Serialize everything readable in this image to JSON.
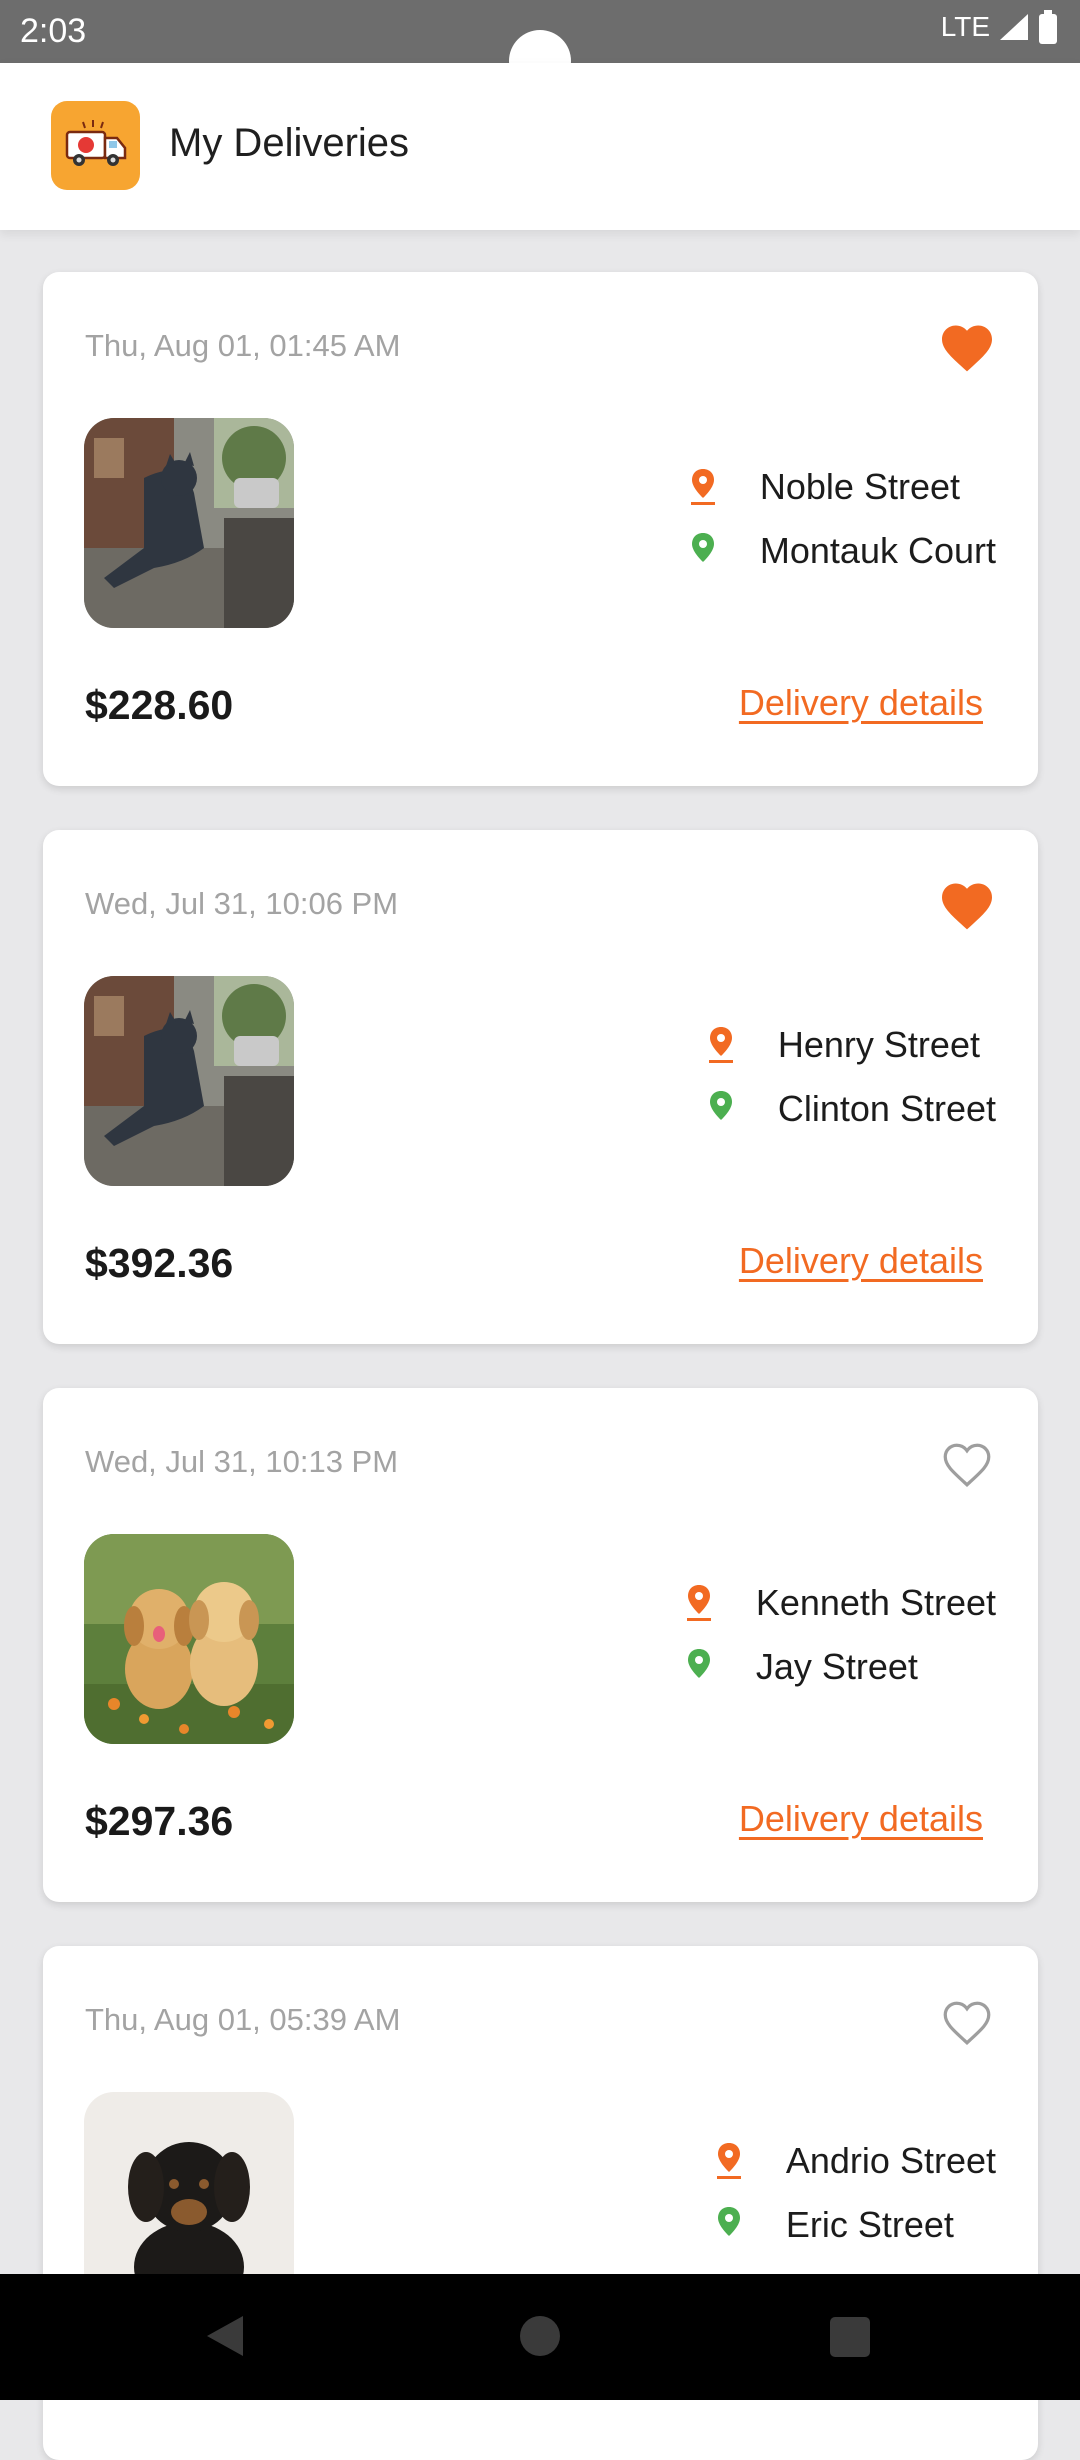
{
  "status_bar": {
    "time": "2:03",
    "network": "LTE"
  },
  "app_bar": {
    "title": "My Deliveries",
    "logo_icon": "delivery-truck-icon"
  },
  "colors": {
    "accent": "#f26a22",
    "origin_pin": "#f26a22",
    "destination_pin": "#4caf50",
    "favorite": "#f26a22"
  },
  "deliveries": [
    {
      "date": "Thu, Aug 01, 01:45 AM",
      "favorited": true,
      "image": "cat-statue",
      "from": "Noble Street",
      "to": "Montauk Court",
      "price": "$228.60",
      "details_label": "Delivery details"
    },
    {
      "date": "Wed, Jul 31, 10:06 PM",
      "favorited": true,
      "image": "cat-statue",
      "from": "Henry Street",
      "to": "Clinton Street",
      "price": "$392.36",
      "details_label": "Delivery details"
    },
    {
      "date": "Wed, Jul 31, 10:13 PM",
      "favorited": false,
      "image": "golden-puppies",
      "from": "Kenneth Street",
      "to": "Jay Street",
      "price": "$297.36",
      "details_label": "Delivery details"
    },
    {
      "date": "Thu, Aug 01, 05:39 AM",
      "favorited": false,
      "image": "black-puppy",
      "from": "Andrio Street",
      "to": "Eric Street",
      "price": "",
      "details_label": ""
    }
  ],
  "nav": {
    "back": "back-icon",
    "home": "home-icon",
    "recents": "recents-icon"
  }
}
